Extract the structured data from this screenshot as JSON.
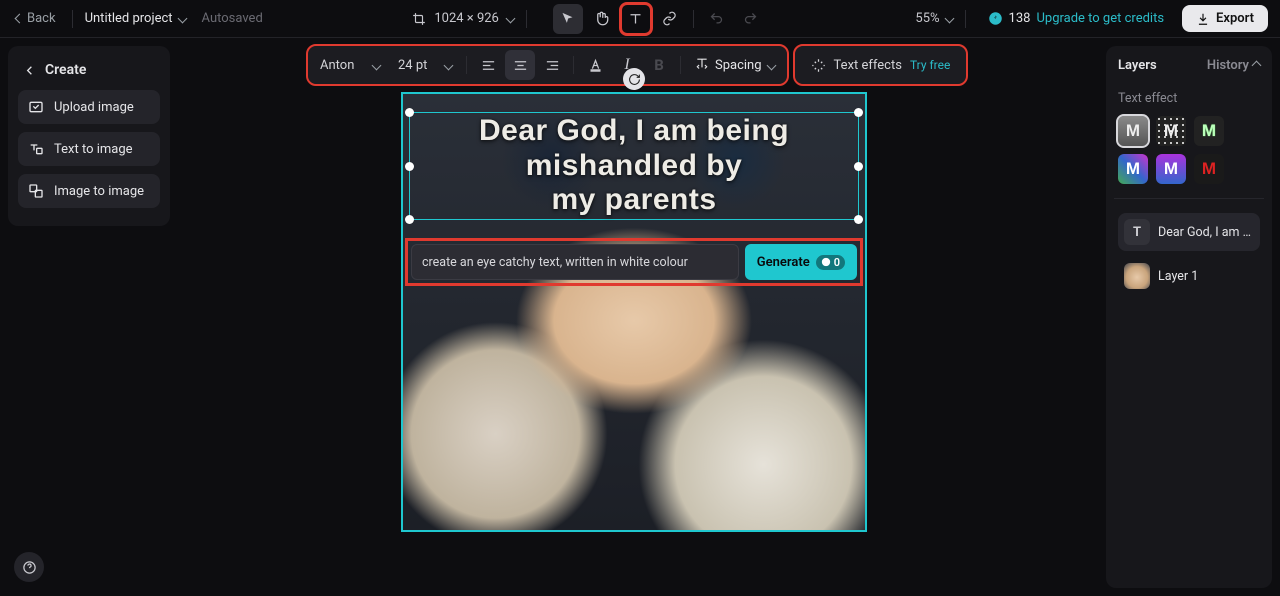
{
  "top": {
    "back": "Back",
    "project": "Untitled project",
    "autosaved": "Autosaved",
    "dimensions": "1024 × 926",
    "zoom": "55%",
    "credits": "138",
    "upgrade": "Upgrade to get credits",
    "export": "Export"
  },
  "textbar": {
    "font": "Anton",
    "size": "24 pt",
    "spacing": "Spacing",
    "texteffects": "Text effects",
    "tryfree": "Try free"
  },
  "left": {
    "header": "Create",
    "upload": "Upload image",
    "text2img": "Text to image",
    "img2img": "Image to image"
  },
  "canvas": {
    "overlay_line1": "Dear God, I am being mishandled by",
    "overlay_line2": "my parents",
    "prompt_value": "create an eye catchy text, written in white colour",
    "generate": "Generate",
    "gen_cost": "0"
  },
  "right": {
    "tab_layers": "Layers",
    "tab_history": "History",
    "section_effect": "Text effect",
    "layer_text": "Dear God, I am b…",
    "layer_img": "Layer 1"
  },
  "effects_glyph": "M"
}
